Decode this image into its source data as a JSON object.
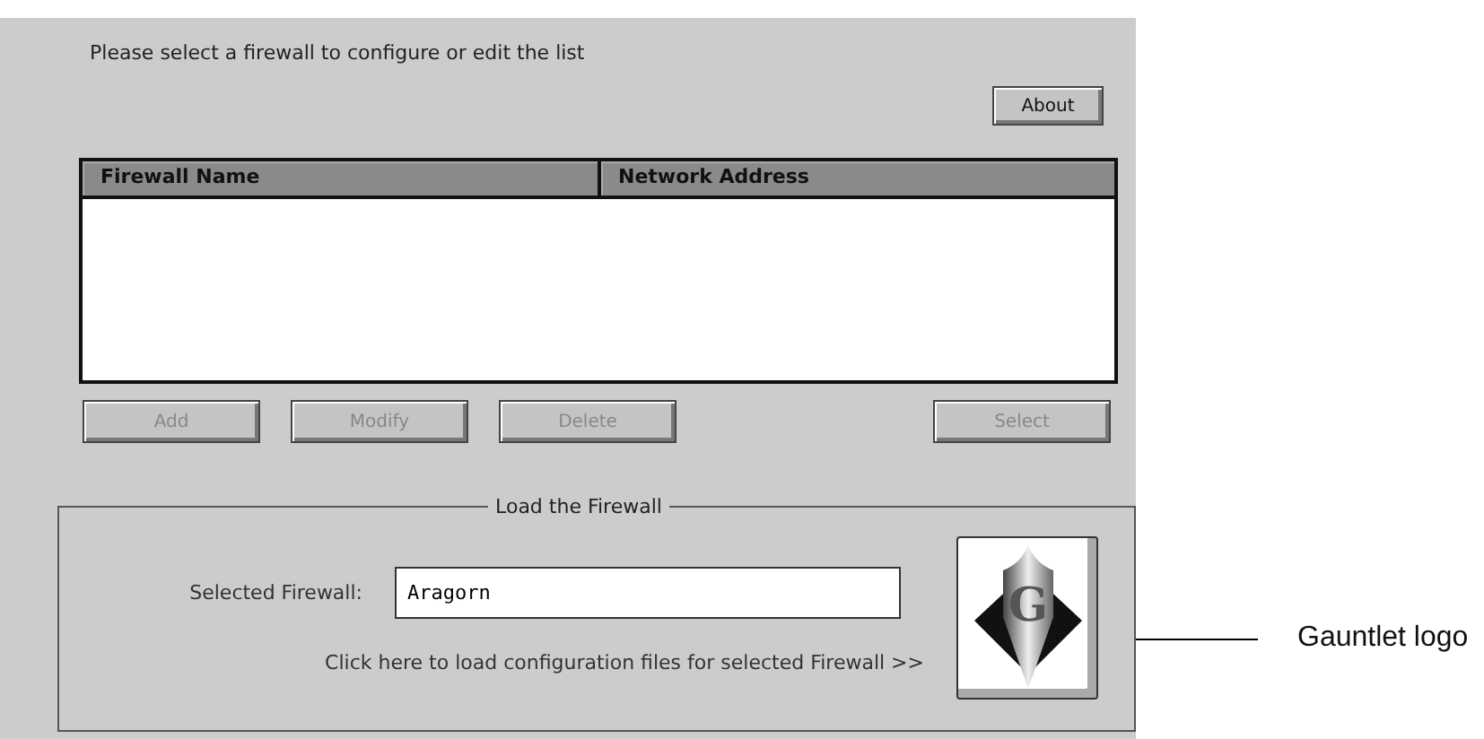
{
  "instruction": "Please select a firewall to configure or edit the list",
  "about_button": {
    "label": "About",
    "disabled": false
  },
  "table": {
    "columns": [
      "Firewall Name",
      "Network Address"
    ]
  },
  "list_buttons": [
    {
      "label": "Add",
      "disabled": true
    },
    {
      "label": "Modify",
      "disabled": true
    },
    {
      "label": "Delete",
      "disabled": true
    },
    {
      "label": "Select",
      "disabled": true
    }
  ],
  "load_group": {
    "title": "Load the Firewall",
    "field_label": "Selected Firewall:",
    "field_value": "Aragorn",
    "hint": "Click here to load configuration files for selected Firewall >>",
    "logo_letter": "G"
  },
  "callout": "Gauntlet logo"
}
